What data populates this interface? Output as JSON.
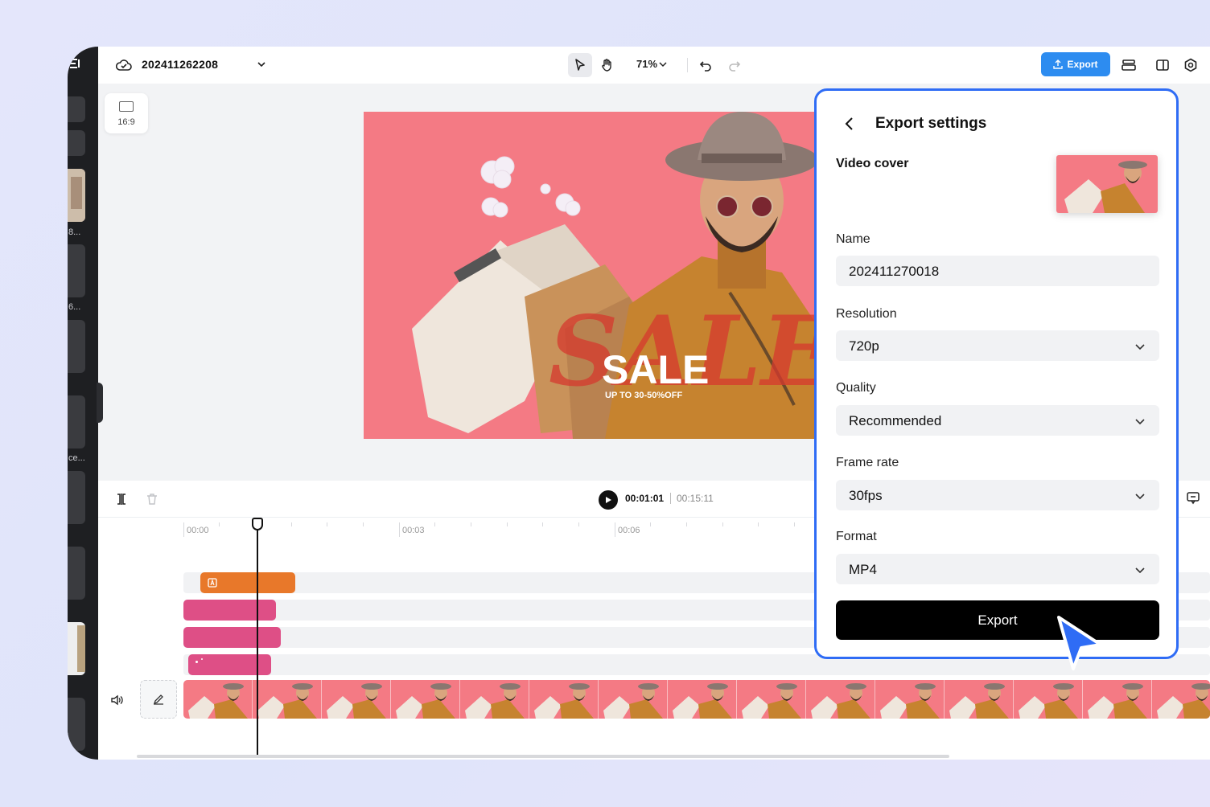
{
  "app": {
    "project_title": "202411262208",
    "zoom": "71%",
    "export_button": "Export",
    "aspect_ratio": "16:9"
  },
  "sidebar": {
    "labels": [
      "8...",
      "6...",
      "ce..."
    ]
  },
  "preview": {
    "headline": "SALE",
    "subline": "UP TO 30-50%OFF",
    "script_word": "SALE"
  },
  "timeline": {
    "current_time": "00:01:01",
    "total_time": "00:15:11",
    "ruler": [
      "00:00",
      "00:03",
      "00:06"
    ]
  },
  "export_panel": {
    "title": "Export settings",
    "cover_label": "Video cover",
    "name_label": "Name",
    "name_value": "202411270018",
    "resolution_label": "Resolution",
    "resolution_value": "720p",
    "quality_label": "Quality",
    "quality_value": "Recommended",
    "framerate_label": "Frame rate",
    "framerate_value": "30fps",
    "format_label": "Format",
    "format_value": "MP4",
    "export_label": "Export"
  },
  "colors": {
    "accent_blue": "#2d8cf0",
    "panel_border": "#2f6cf5",
    "clip_orange": "#e8782a",
    "clip_pink": "#de4f86",
    "preview_bg": "#f47a84"
  }
}
